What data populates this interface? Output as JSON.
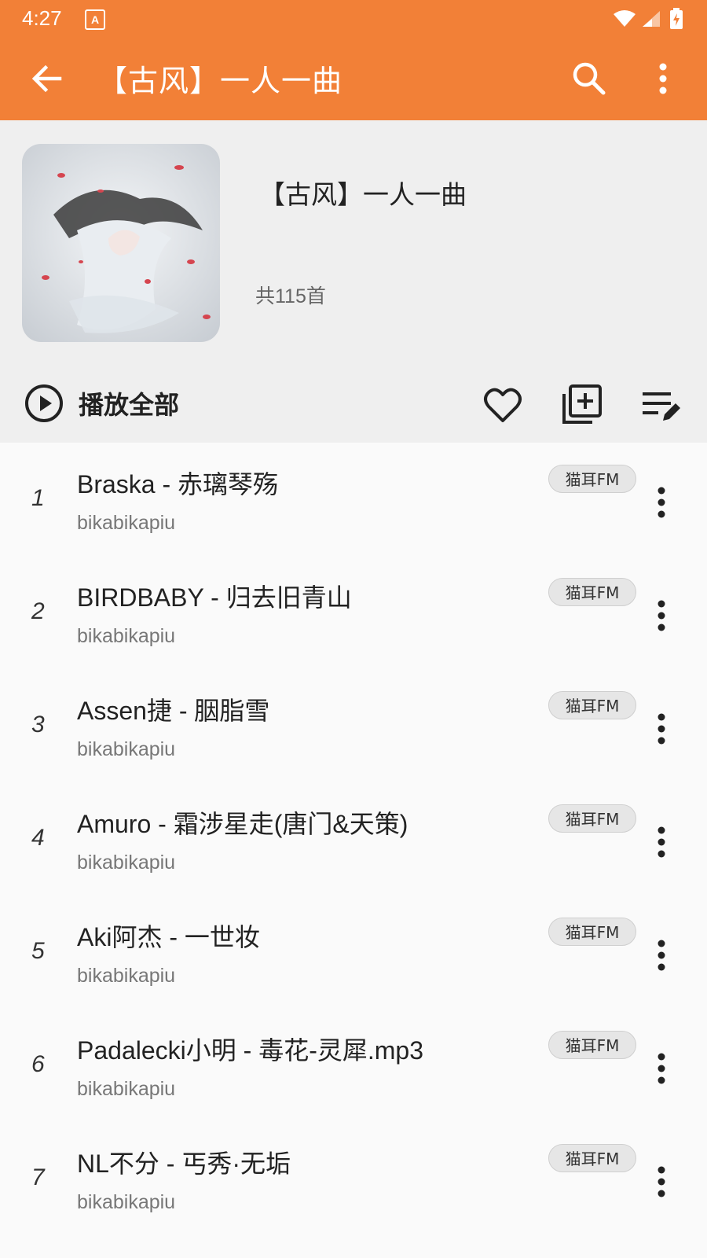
{
  "status_bar": {
    "time": "4:27",
    "notification_icon": "A"
  },
  "app_bar": {
    "title": "【古风】一人一曲",
    "back_icon": "arrow-left",
    "search_icon": "search",
    "more_icon": "more-vertical"
  },
  "playlist": {
    "title": "【古风】一人一曲",
    "count": "共115首",
    "play_all_label": "播放全部"
  },
  "colors": {
    "accent": "#f28037",
    "header_bg": "#efefef",
    "list_bg": "#fafafa"
  },
  "songs": [
    {
      "index": "1",
      "title": "Braska - 赤璃琴殇",
      "artist": "bikabikapiu",
      "source": "猫耳FM"
    },
    {
      "index": "2",
      "title": "BIRDBABY - 归去旧青山",
      "artist": "bikabikapiu",
      "source": "猫耳FM"
    },
    {
      "index": "3",
      "title": "Assen捷 - 胭脂雪",
      "artist": "bikabikapiu",
      "source": "猫耳FM"
    },
    {
      "index": "4",
      "title": "Amuro - 霜涉星走(唐门&天策)",
      "artist": "bikabikapiu",
      "source": "猫耳FM"
    },
    {
      "index": "5",
      "title": "Aki阿杰 - 一世妆",
      "artist": "bikabikapiu",
      "source": "猫耳FM"
    },
    {
      "index": "6",
      "title": "Padalecki小明 - 毒花-灵犀.mp3",
      "artist": "bikabikapiu",
      "source": "猫耳FM"
    },
    {
      "index": "7",
      "title": "NL不分 - 丐秀·无垢",
      "artist": "bikabikapiu",
      "source": "猫耳FM"
    }
  ]
}
